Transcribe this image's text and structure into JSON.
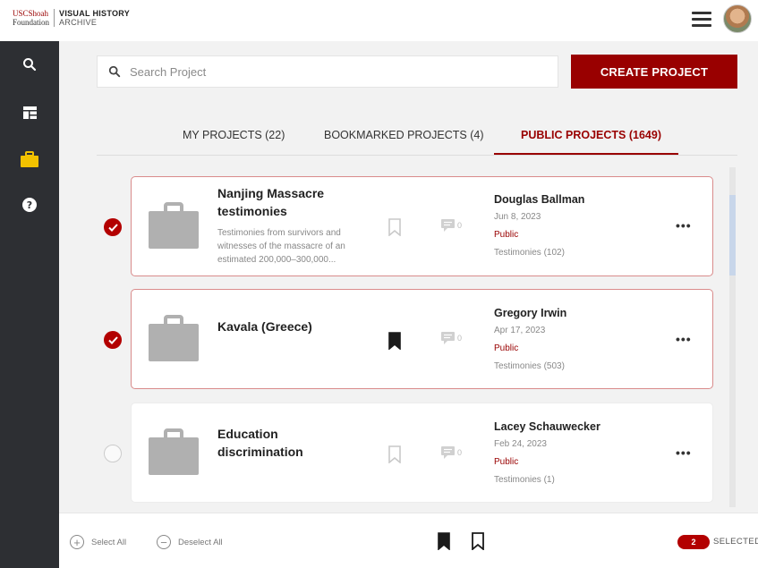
{
  "header": {
    "logo_left_line1": "USCShoah",
    "logo_left_line2": "Foundation",
    "logo_right_line1": "VISUAL HISTORY",
    "logo_right_line2": "ARCHIVE",
    "menu_icon": "hamburger-menu-icon",
    "avatar_icon": "user-avatar"
  },
  "sidebar": {
    "items": [
      {
        "icon": "search-icon",
        "active": false
      },
      {
        "icon": "dashboard-icon",
        "active": false
      },
      {
        "icon": "briefcase-icon",
        "active": true
      },
      {
        "icon": "help-icon",
        "active": false
      }
    ]
  },
  "search": {
    "placeholder": "Search Project",
    "value": ""
  },
  "create_button": "CREATE PROJECT",
  "tabs": [
    {
      "label": "MY PROJECTS (22)",
      "active": false
    },
    {
      "label": "BOOKMARKED PROJECTS (4)",
      "active": false
    },
    {
      "label": "PUBLIC PROJECTS (1649)",
      "active": true
    }
  ],
  "projects": [
    {
      "title": "Nanjing Massacre testimonies",
      "description": "Testimonies from survivors and witnesses of the massacre of an estimated 200,000–300,000...",
      "owner": "Douglas Ballman",
      "date": "Jun 8, 2023",
      "visibility": "Public",
      "testimonies": "Testimonies (102)",
      "comments": "0",
      "bookmarked": false,
      "selected": true,
      "more": "•••"
    },
    {
      "title": "Kavala (Greece)",
      "description": "",
      "owner": "Gregory Irwin",
      "date": "Apr 17, 2023",
      "visibility": "Public",
      "testimonies": "Testimonies (503)",
      "comments": "0",
      "bookmarked": true,
      "selected": true,
      "more": "•••"
    },
    {
      "title": "Education discrimination",
      "description": "",
      "owner": "Lacey Schauwecker",
      "date": "Feb 24, 2023",
      "visibility": "Public",
      "testimonies": "Testimonies (1)",
      "comments": "0",
      "bookmarked": false,
      "selected": false,
      "more": "•••"
    }
  ],
  "bottom_bar": {
    "select_all": "Select All",
    "deselect_all": "Deselect All",
    "selected_count": "2",
    "selected_label": "SELECTED"
  },
  "colors": {
    "brand": "#990000",
    "sidebar": "#2d2f33",
    "active_icon": "#f2c200"
  }
}
